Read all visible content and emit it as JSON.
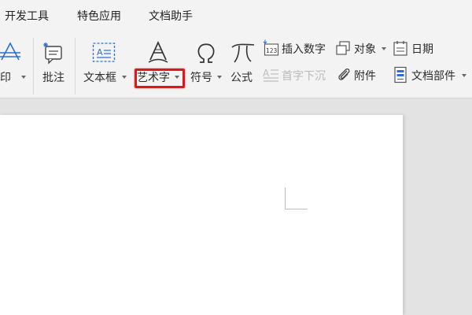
{
  "tabs": [
    {
      "label": "开发工具"
    },
    {
      "label": "特色应用"
    },
    {
      "label": "文档助手"
    }
  ],
  "ribbon": {
    "watermark_label": "水印",
    "comment_label": "批注",
    "textbox_label": "文本框",
    "wordart_label": "艺术字",
    "symbol_label": "符号",
    "formula_label": "公式",
    "insert_number_label": "插入数字",
    "drop_cap_label": "首字下沉",
    "object_label": "对象",
    "attachment_label": "附件",
    "date_label": "日期",
    "doc_parts_label": "文档部件"
  },
  "colors": {
    "accent": "#2b6fd6",
    "highlight": "#e0161b"
  }
}
